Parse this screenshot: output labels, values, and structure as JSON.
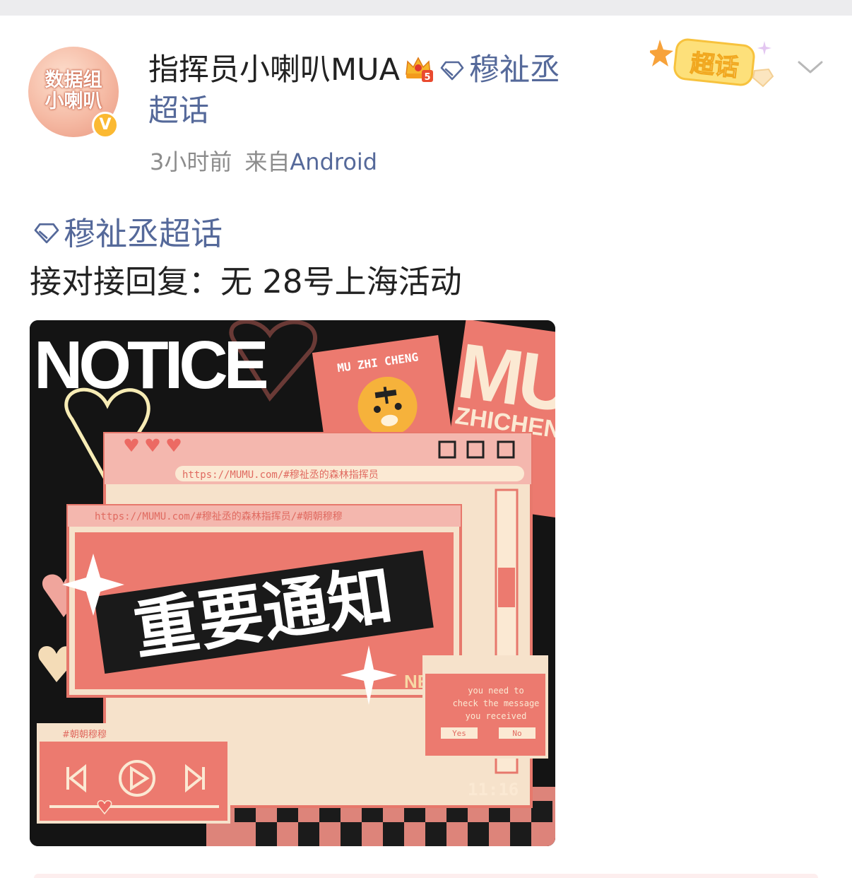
{
  "post": {
    "author": {
      "avatar_line1": "数据组",
      "avatar_line2": "小喇叭",
      "verified_badge": "V",
      "name": "指挥员小喇叭MUA",
      "level_icon": "crown-level-5-icon",
      "level_label": "5"
    },
    "topic_header_link": "穆祉丞超话",
    "time": "3小时前",
    "source_prefix": "来自",
    "source_device": "Android",
    "super_topic_badge": "超话",
    "topic_tag": "穆祉丞超话",
    "text": "接对接回复：无 28号上海活动"
  },
  "image": {
    "notice": "NOTICE",
    "stamp_text": "MU ZHI CHENG",
    "poster_big": "MU",
    "poster_sub": "ZHICHENG",
    "browser_url": "https://MUMU.com/#穆祉丞的森林指挥员",
    "window2_url": "https://MUMU.com/#穆祉丞的森林指挥员/#朝朝穆穆",
    "headline": "重要通知",
    "new_tag": "NEW",
    "dialog_line1": "you need to",
    "dialog_line2": "check the message",
    "dialog_line3": "you received",
    "dialog_yes": "Yes",
    "dialog_no": "No",
    "player_title": "#朝朝穆穆",
    "clock": "11:16",
    "colors": {
      "salmon": "#ec7a6f",
      "cream": "#fbe9d3",
      "pink": "#f4b7ae",
      "dark": "#1a1a1a",
      "link": "#55699a"
    }
  }
}
